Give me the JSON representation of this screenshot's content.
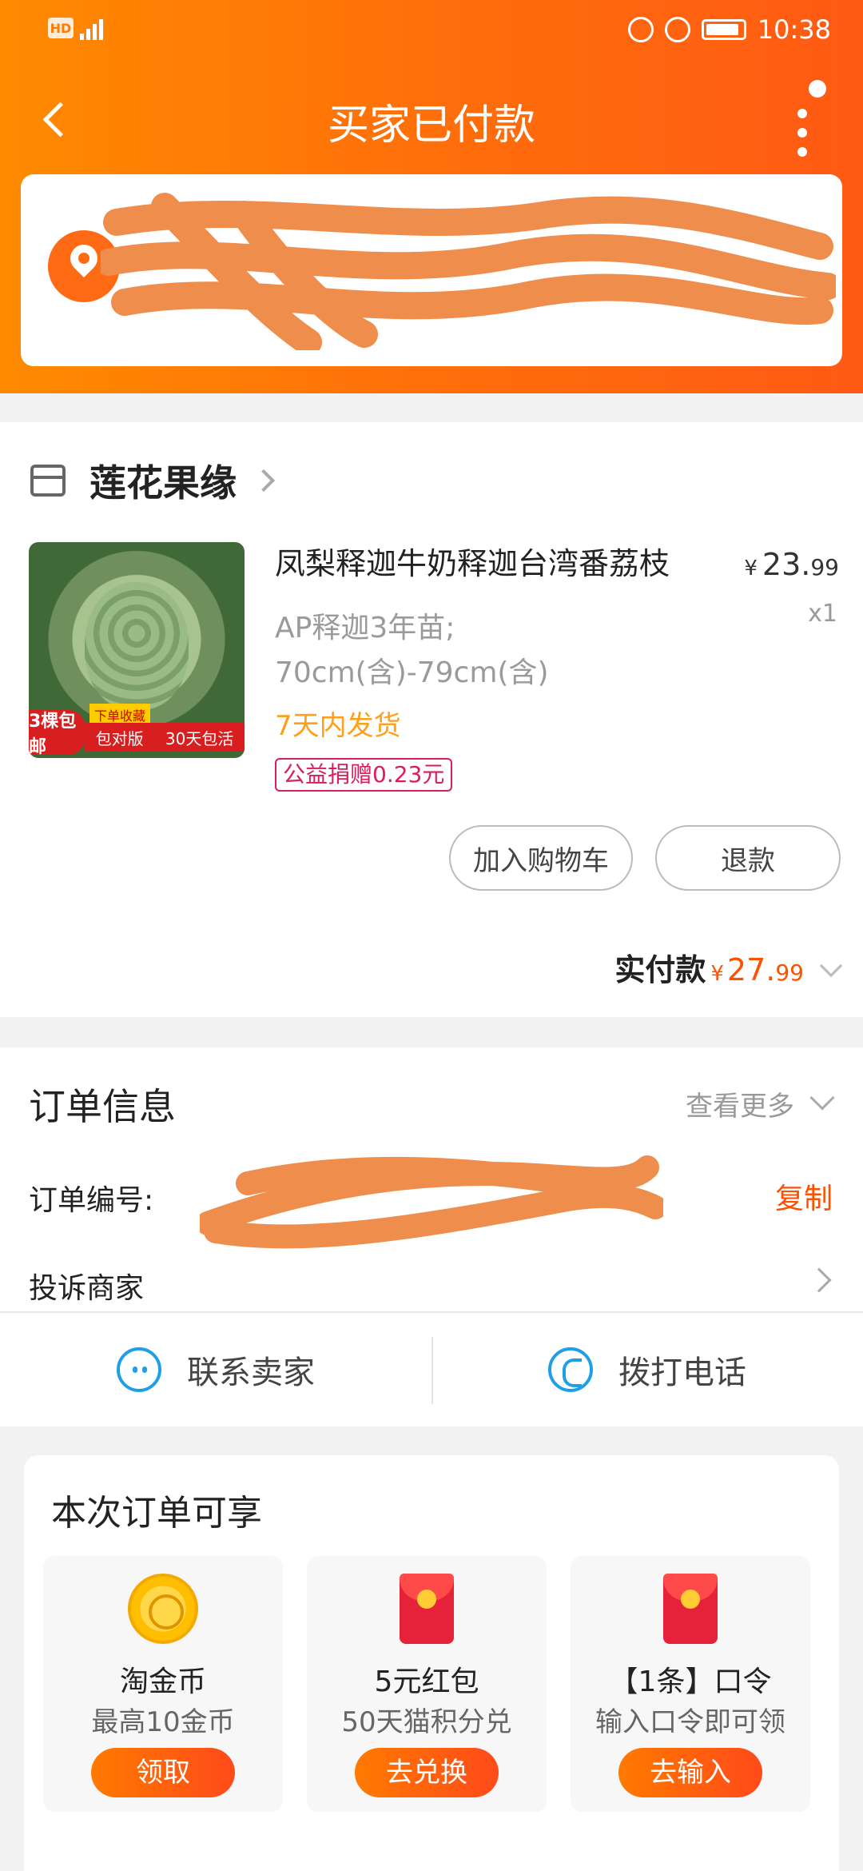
{
  "status_bar": {
    "hd": "HD",
    "network": "4G",
    "time": "10:38"
  },
  "navbar": {
    "title": "买家已付款"
  },
  "shop": {
    "name": "莲花果缘"
  },
  "product": {
    "title": "凤梨释迦牛奶释迦台湾番荔枝",
    "price_currency": "¥",
    "price_int": "23.",
    "price_dec": "99",
    "quantity": "x1",
    "spec_line1": "AP释迦3年苗;",
    "spec_line2": "70cm(含)-79cm(含)",
    "shipping": "7天内发货",
    "charity": "公益捐赠0.23元",
    "image_badges": {
      "left": "3棵包邮",
      "top": "下单收藏",
      "mid": "包对版",
      "right": "30天包活"
    }
  },
  "actions": {
    "add_cart": "加入购物车",
    "refund": "退款"
  },
  "paid": {
    "label": "实付款",
    "currency": "¥",
    "int": "27.",
    "dec": "99"
  },
  "order_info": {
    "title": "订单信息",
    "more": "查看更多",
    "order_no_label": "订单编号:",
    "copy": "复制",
    "complain": "投诉商家"
  },
  "contact": {
    "seller": "联系卖家",
    "phone": "拨打电话"
  },
  "benefits": {
    "title": "本次订单可享",
    "items": [
      {
        "name": "淘金币",
        "desc": "最高10金币",
        "button": "领取",
        "icon": "gold-coin-icon"
      },
      {
        "name": "5元红包",
        "desc": "50天猫积分兑",
        "button": "去兑换",
        "icon": "red-packet-icon"
      },
      {
        "name": "【1条】口令",
        "desc": "输入口令即可领",
        "button": "去输入",
        "icon": "red-packet-icon"
      }
    ]
  },
  "colors": {
    "brand": "#ff6f0a",
    "price": "#ff5000",
    "link": "#1e9fe8"
  }
}
